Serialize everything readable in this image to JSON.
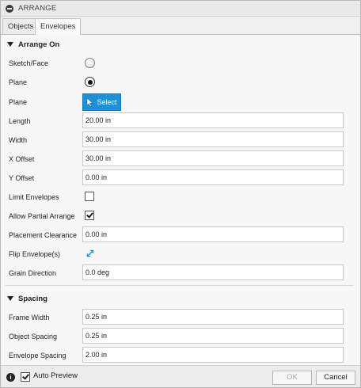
{
  "dialog": {
    "title": "ARRANGE"
  },
  "tabs": [
    {
      "label": "Objects",
      "active": false
    },
    {
      "label": "Envelopes",
      "active": true
    }
  ],
  "arrange_on": {
    "header": "Arrange On",
    "sketch_face_label": "Sketch/Face",
    "plane_radio_label": "Plane",
    "plane_select_label": "Plane",
    "select_button": "Select",
    "length_label": "Length",
    "length_value": "20.00 in",
    "width_label": "Width",
    "width_value": "30.00 in",
    "x_offset_label": "X Offset",
    "x_offset_value": "30.00 in",
    "y_offset_label": "Y Offset",
    "y_offset_value": "0.00 in",
    "limit_envelopes_label": "Limit Envelopes",
    "limit_envelopes_checked": false,
    "allow_partial_label": "Allow Partial Arrange",
    "allow_partial_checked": true,
    "placement_clearance_label": "Placement Clearance",
    "placement_clearance_value": "0.00 in",
    "flip_envelope_label": "Flip Envelope(s)",
    "grain_direction_label": "Grain Direction",
    "grain_direction_value": "0.0 deg"
  },
  "spacing": {
    "header": "Spacing",
    "frame_width_label": "Frame Width",
    "frame_width_value": "0.25 in",
    "object_spacing_label": "Object Spacing",
    "object_spacing_value": "0.25 in",
    "envelope_spacing_label": "Envelope Spacing",
    "envelope_spacing_value": "2.00 in"
  },
  "footer": {
    "auto_preview_label": "Auto Preview",
    "auto_preview_checked": true,
    "ok_label": "OK",
    "ok_enabled": false,
    "cancel_label": "Cancel"
  },
  "colors": {
    "select_button_bg": "#1f8fd6",
    "flip_icon": "#1f8fd6"
  },
  "icons": {
    "title": "minus-circle-icon",
    "section_toggle": "triangle-down-icon",
    "select": "cursor-arrow-icon",
    "flip": "flip-arrows-icon",
    "info": "info-icon"
  }
}
